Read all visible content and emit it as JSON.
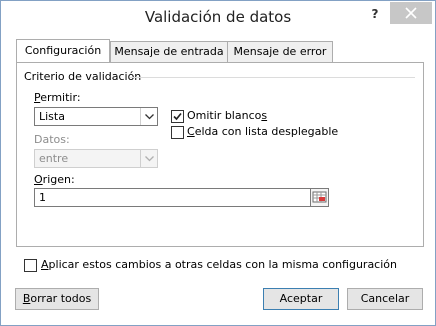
{
  "window": {
    "title": "Validación de datos"
  },
  "tabs": [
    {
      "label": "Configuración"
    },
    {
      "label": "Mensaje de entrada"
    },
    {
      "label": "Mensaje de error"
    }
  ],
  "criteria": {
    "group_label": "Criterio de validación",
    "allow": {
      "label_prefix": "P",
      "label_rest": "ermitir:",
      "value": "Lista"
    },
    "ignore_blank": {
      "label_prefix": "Omitir blanco",
      "label_ul": "s",
      "checked": true
    },
    "in_cell_dropdown": {
      "label_ul": "C",
      "label_rest": "elda con lista desplegable",
      "checked": false
    },
    "data": {
      "label": "Datos:",
      "value": "entre"
    },
    "source": {
      "label_ul": "O",
      "label_rest": "rigen:",
      "value": "1"
    }
  },
  "apply_all": {
    "label_ul": "A",
    "label_rest": "plicar estos cambios a otras celdas con la misma configuración",
    "checked": false
  },
  "buttons": {
    "clear_all_ul": "B",
    "clear_all_rest": "orrar todos",
    "ok": "Aceptar",
    "cancel": "Cancelar"
  },
  "icons": {
    "help": "?",
    "close": "close-icon",
    "dropdown": "chevron-down-icon",
    "collapse": "range-selector-icon"
  }
}
